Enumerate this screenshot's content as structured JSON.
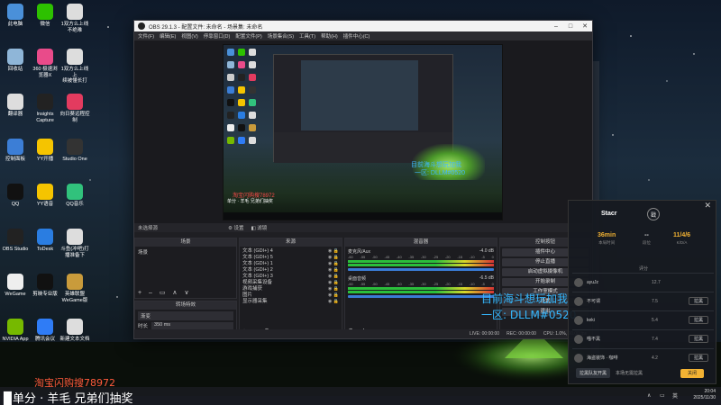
{
  "desktop": {
    "icons": [
      {
        "label": "此电脑",
        "icon": "computer-icon",
        "color": "#4a90d9"
      },
      {
        "label": "微信",
        "icon": "wechat-icon",
        "color": "#2dc100"
      },
      {
        "label": "1双方么上线\n不绝难",
        "icon": "document-icon",
        "color": "#dddddd"
      },
      {
        "label": "回收站",
        "icon": "recycle-bin-icon",
        "color": "#8fb6d8"
      },
      {
        "label": "360 极速浏\n览器X",
        "icon": "browser-icon",
        "color": "#e94b8a"
      },
      {
        "label": "1双方么上线上\n续被懂长打",
        "icon": "document-icon",
        "color": "#dddddd"
      },
      {
        "label": "翻译器",
        "icon": "translate-icon",
        "color": "#dddddd"
      },
      {
        "label": "Insights\nCapture",
        "icon": "camera-icon",
        "color": "#222222"
      },
      {
        "label": "向日葵远程控\n制",
        "icon": "sunflower-icon",
        "color": "#e33b5f"
      },
      {
        "label": "控制面板",
        "icon": "control-panel-icon",
        "color": "#3c7ed6"
      },
      {
        "label": "YY开播",
        "icon": "yy-live-icon",
        "color": "#f5c400"
      },
      {
        "label": "Studio One",
        "icon": "studio-one-icon",
        "color": "#333333"
      },
      {
        "label": "QQ",
        "icon": "qq-icon",
        "color": "#111111"
      },
      {
        "label": "YY语音",
        "icon": "yy-voice-icon",
        "color": "#f5c400"
      },
      {
        "label": "QQ音乐",
        "icon": "qq-music-icon",
        "color": "#31c27c"
      },
      {
        "label": "OBS Studio",
        "icon": "obs-icon",
        "color": "#222222"
      },
      {
        "label": "ToDesk",
        "icon": "todesk-icon",
        "color": "#2a7de1"
      },
      {
        "label": "斗鱼(冲吧)打\n播准备下",
        "icon": "document-icon",
        "color": "#dddddd"
      },
      {
        "label": "WeGame",
        "icon": "wegame-icon",
        "color": "#eeeeee"
      },
      {
        "label": "剪映专业版",
        "icon": "capcut-icon",
        "color": "#111111"
      },
      {
        "label": "英雄联盟\nWeGame版",
        "icon": "lol-icon",
        "color": "#c99b3b"
      },
      {
        "label": "NVIDIA App",
        "icon": "nvidia-icon",
        "color": "#76b900"
      },
      {
        "label": "腾讯会议",
        "icon": "tencent-meeting-icon",
        "color": "#2f7cf6"
      },
      {
        "label": "新建文本文档",
        "icon": "text-document-icon",
        "color": "#dddddd"
      }
    ]
  },
  "obs": {
    "title": "OBS 29.1.3 - 配置文件: 未命名 - 场景集: 未命名",
    "menu": [
      "文件(F)",
      "编辑(E)",
      "视图(V)",
      "停靠窗口(D)",
      "配置文件(P)",
      "场景集合(S)",
      "工具(T)",
      "帮助(H)",
      "插件中心(C)"
    ],
    "preview_text": {
      "red": "淘宝闪购搜78972",
      "red_sub": "单分 · 羊毛 兄弟们抽奖",
      "blue_line1": "目前海斗想玩加我",
      "blue_line2": "一区: DLLM#0520"
    },
    "tabs": [
      "未选择源",
      "设置",
      "滤镜"
    ],
    "scenes": {
      "title": "场景",
      "items": [
        "场景"
      ]
    },
    "transitions": {
      "title": "转场特效",
      "type": "渐变",
      "duration_label": "时长",
      "duration": "350 ms"
    },
    "sources": {
      "title": "来源",
      "items": [
        "文本 (GDI+) 4",
        "文本 (GDI+) 5",
        "文本 (GDI+) 1",
        "文本 (GDI+) 2",
        "文本 (GDI+) 3",
        "视频采集设备",
        "游戏捕获",
        "图片",
        "显示器采集"
      ]
    },
    "mixer": {
      "title": "混音器",
      "channels": [
        {
          "name": "麦克风/Aux",
          "db": "-4.0 dB"
        },
        {
          "name": "桌面音频",
          "db": "-6.5 dB"
        }
      ],
      "scale": [
        "-60",
        "-55",
        "-50",
        "-45",
        "-40",
        "-35",
        "-30",
        "-25",
        "-20",
        "-15",
        "-10",
        "-5",
        "0"
      ]
    },
    "controls": {
      "title": "控制按钮",
      "buttons": [
        "插件中心",
        "停止直播",
        "启动虚拟摄像机",
        "开始录制",
        "工作室模式",
        "设置",
        "退出"
      ]
    },
    "status": {
      "live": "LIVE: 00:00:00",
      "rec": "REC: 00:00:00",
      "cpu": "CPU: 1.0%, 60.00 fps"
    }
  },
  "overlay": {
    "blue_line1": "目前海斗想玩加我",
    "blue_line2": "一区: DLLM#0520",
    "red": "淘宝闪购搜78972",
    "bottom": "单分 · 羊毛 兄弟们抽奖"
  },
  "stats_panel": {
    "name": "Stacr",
    "badge": "戳",
    "stats": [
      {
        "value": "36min",
        "label": "本局时间"
      },
      {
        "value": "--",
        "label": "段位"
      },
      {
        "value": "11/4/6",
        "label": "K/D/A"
      }
    ],
    "header": "评分",
    "players": [
      {
        "name": "ayuJz",
        "score": "12.7",
        "action": ""
      },
      {
        "name": "不可谓",
        "score": "7.5",
        "action": "拉黑"
      },
      {
        "name": "keki",
        "score": "5.4",
        "action": "拉黑"
      },
      {
        "name": "喵不黑",
        "score": "7.4",
        "action": "拉黑"
      },
      {
        "name": "海盗装饰 · 咖啡",
        "score": "4.2",
        "action": "拉黑"
      }
    ],
    "footer": {
      "btn1": "拉黑队友开黑",
      "btn2": "本场无需拉黑",
      "btn3": "关闭"
    }
  },
  "taskbar": {
    "lang": "英",
    "time": "20:04",
    "date": "2025/11/30"
  }
}
